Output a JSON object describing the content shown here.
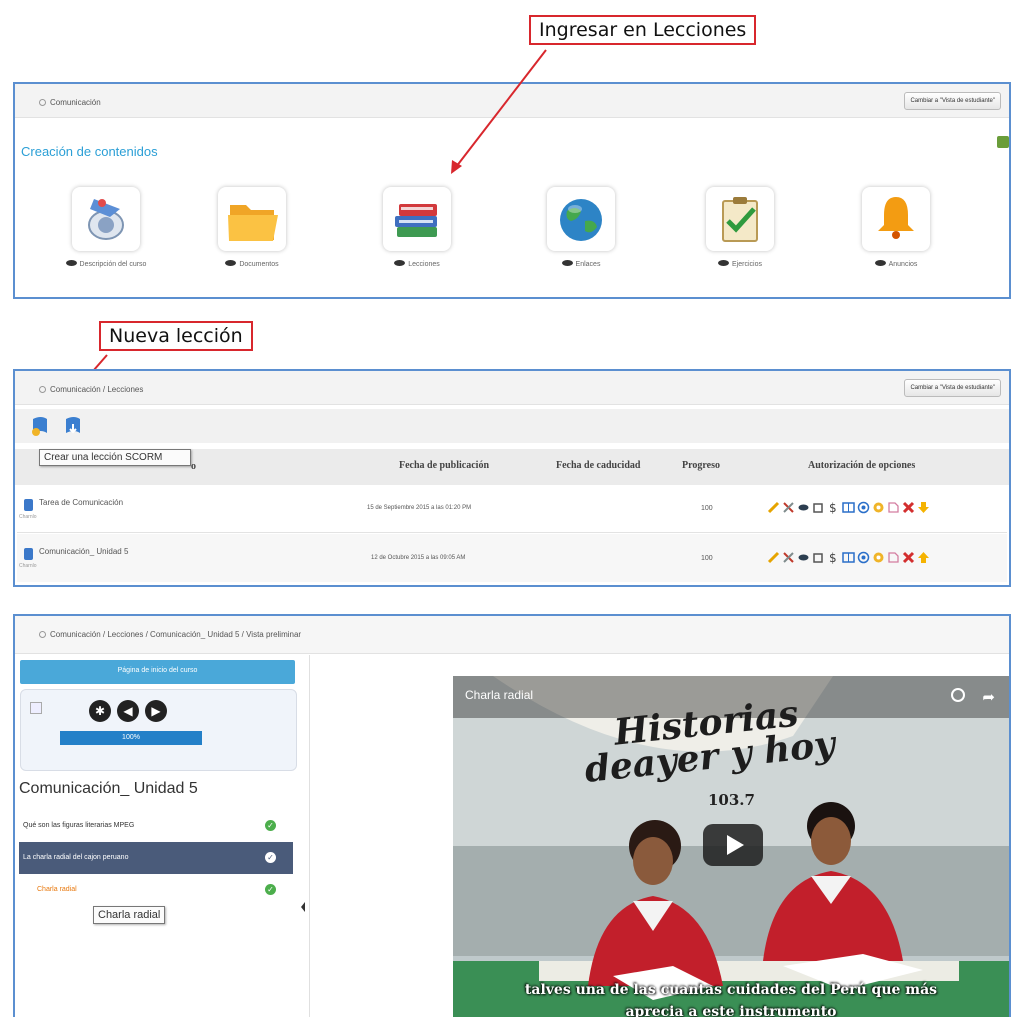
{
  "callouts": {
    "ingresar": "Ingresar en Lecciones",
    "nueva": "Nueva lección"
  },
  "panel1": {
    "breadcrumb": "Comunicación",
    "view_button": "Cambiar a \"Vista de estudiante\"",
    "section_title": "Creación de contenidos",
    "tools": [
      {
        "label": "Descripción del curso",
        "icon": "course-description-icon"
      },
      {
        "label": "Documentos",
        "icon": "folder-icon"
      },
      {
        "label": "Lecciones",
        "icon": "books-icon"
      },
      {
        "label": "Enlaces",
        "icon": "globe-icon"
      },
      {
        "label": "Ejercicios",
        "icon": "checklist-icon"
      },
      {
        "label": "Anuncios",
        "icon": "bell-icon"
      }
    ]
  },
  "panel2": {
    "breadcrumb": "Comunicación / Lecciones",
    "view_button": "Cambiar a \"Vista de estudiante\"",
    "tooltip": "Crear una lección SCORM",
    "columns": [
      "Fecha de publicación",
      "Fecha de caducidad",
      "Progreso",
      "Autorización de opciones"
    ],
    "rows": [
      {
        "name": "Tarea de Comunicación",
        "author": "Charnlo",
        "published": "15 de Septiembre 2015 a las 01:20 PM",
        "expires": "",
        "progress": "100"
      },
      {
        "name": "Comunicación_ Unidad 5",
        "author": "Charnlo",
        "published": "12 de Octubre 2015 a las 09:05 AM",
        "expires": "",
        "progress": "100"
      }
    ]
  },
  "panel3": {
    "breadcrumb": "Comunicación / Lecciones / Comunicación_ Unidad 5 / Vista preliminar",
    "home_button": "Página de inicio del curso",
    "progress_label": "100%",
    "progress": 1.0,
    "lesson_title": "Comunicación_ Unidad 5",
    "items": [
      {
        "label": "Qué son las figuras literarias MPEG",
        "selected": false,
        "orange": false
      },
      {
        "label": "La charla radial del cajon peruano",
        "selected": true,
        "orange": false
      },
      {
        "label": "Charla radial",
        "selected": false,
        "orange": true
      }
    ],
    "tooltip": "Charla radial",
    "video": {
      "title": "Charla radial",
      "sign_text": "Historias deayer y hoy",
      "number": "103.7",
      "subtitle_line1": "talves una de las cuantas cuidades del Perú que más",
      "subtitle_line2": "aprecia a este instrumento"
    }
  },
  "colors": {
    "callout_border": "#d8272d",
    "panel_border": "#5b8fd0",
    "title_blue": "#2b9fd6",
    "selected_item": "#4a5b7a",
    "home_button": "#4aa8d9",
    "orange_text": "#e8790f"
  }
}
